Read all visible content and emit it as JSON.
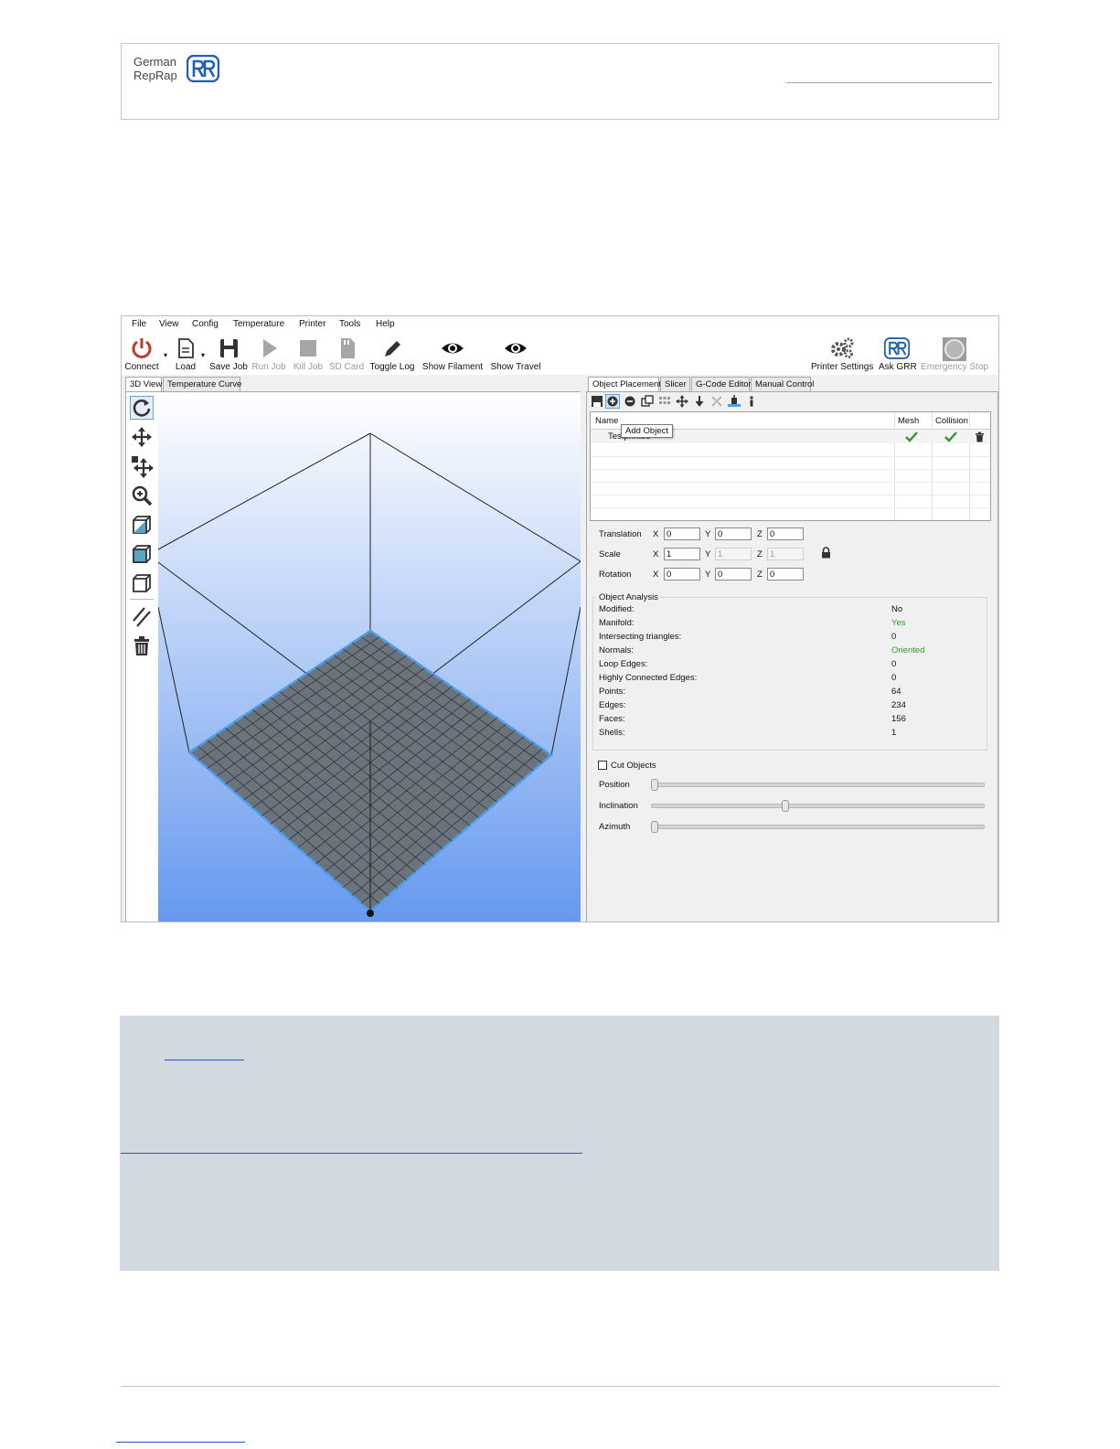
{
  "document": {
    "logo": {
      "line1": "German",
      "line2": "RepRap",
      "mark": "reprap-rr-logo"
    }
  },
  "app": {
    "menu": [
      "File",
      "View",
      "Config",
      "Temperature",
      "Printer",
      "Tools",
      "Help"
    ],
    "toolbar": {
      "connect": "Connect",
      "load": "Load",
      "save_job": "Save Job",
      "run_job": "Run Job",
      "kill_job": "Kill Job",
      "sd_card": "SD Card",
      "toggle_log": "Toggle Log",
      "show_filament": "Show Filament",
      "show_travel": "Show Travel",
      "printer_settings": "Printer Settings",
      "ask_grr": "Ask GRR",
      "emergency_stop": "Emergency Stop"
    },
    "left_tabs": [
      "3D View",
      "Temperature Curve"
    ],
    "right_tabs": [
      "Object Placement",
      "Slicer",
      "G-Code Editor",
      "Manual Control"
    ],
    "object_table": {
      "headers": {
        "name": "Name",
        "mesh": "Mesh",
        "collision": "Collision"
      },
      "rows": [
        {
          "name": "Testprintee"
        }
      ],
      "tooltip": "Add Object"
    },
    "transform": {
      "translation": {
        "label": "Translation",
        "x": "0",
        "y": "0",
        "z": "0"
      },
      "scale": {
        "label": "Scale",
        "x": "1",
        "y": "1",
        "z": "1"
      },
      "rotation": {
        "label": "Rotation",
        "x": "0",
        "y": "0",
        "z": "0"
      },
      "axes": {
        "x": "X",
        "y": "Y",
        "z": "Z"
      }
    },
    "analysis": {
      "title": "Object Analysis",
      "rows": [
        {
          "key": "Modified:",
          "value": "No"
        },
        {
          "key": "Manifold:",
          "value": "Yes"
        },
        {
          "key": "Intersecting triangles:",
          "value": "0"
        },
        {
          "key": "Normals:",
          "value": "Oriented"
        },
        {
          "key": "Loop Edges:",
          "value": "0"
        },
        {
          "key": "Highly Connected Edges:",
          "value": "0"
        },
        {
          "key": "Points:",
          "value": "64"
        },
        {
          "key": "Edges:",
          "value": "234"
        },
        {
          "key": "Faces:",
          "value": "156"
        },
        {
          "key": "Shells:",
          "value": "1"
        }
      ],
      "good_color": "#2e9a2e"
    },
    "cut": {
      "checkbox_label": "Cut Objects",
      "position": "Position",
      "inclination": "Inclination",
      "azimuth": "Azimuth",
      "inclination_level": 0.4
    },
    "colors": {
      "connect": "#c0392b",
      "accent": "#1f5fb4",
      "bed": "#6b737c",
      "sky_top": "#ffffff",
      "sky_bottom": "#6699ee"
    }
  }
}
